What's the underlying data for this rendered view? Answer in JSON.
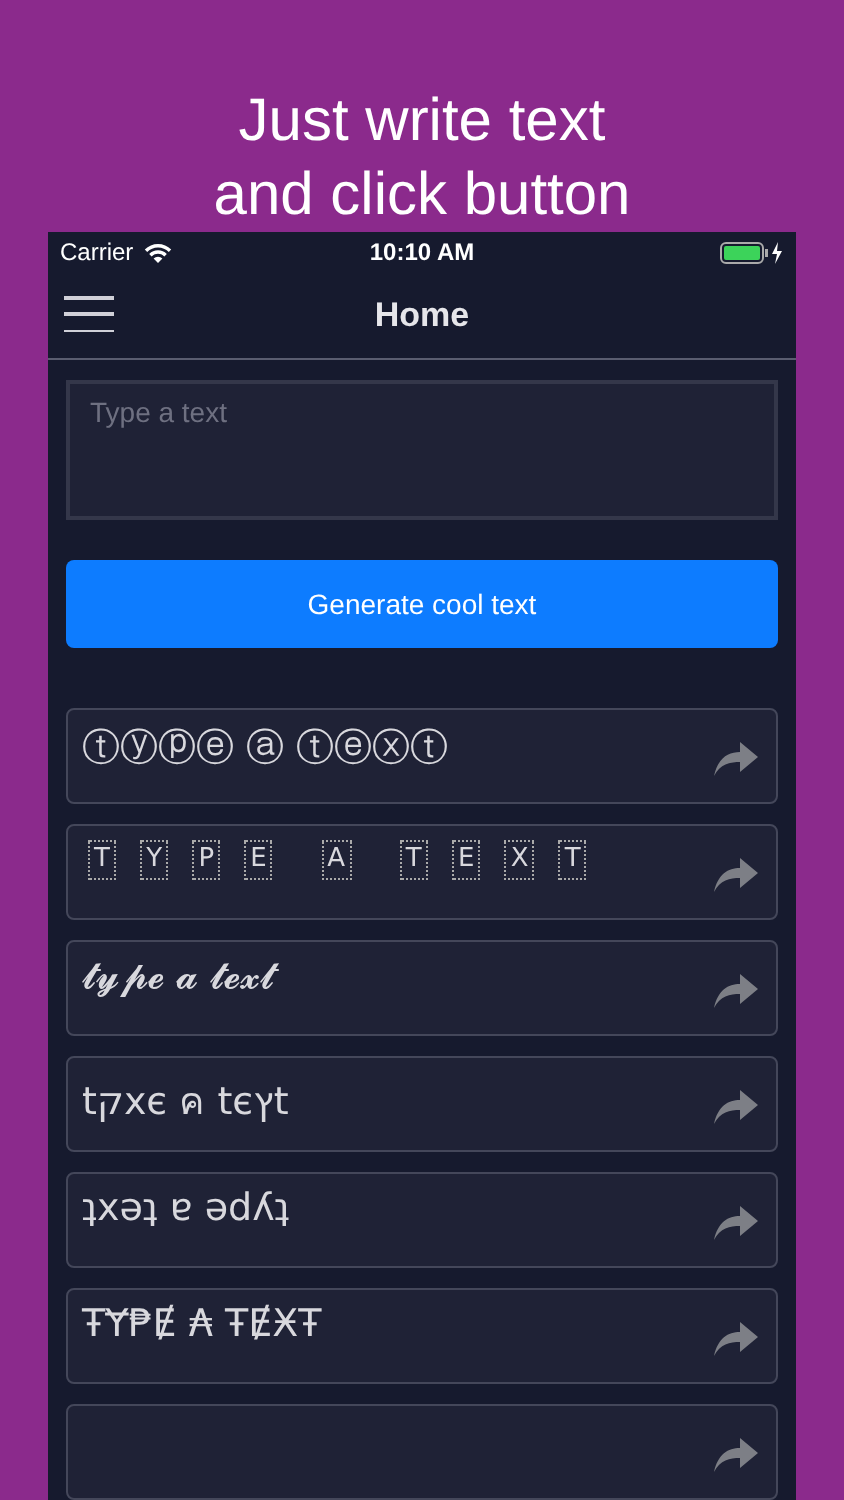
{
  "headline": [
    "Just write text",
    "and click button"
  ],
  "status_bar": {
    "carrier": "Carrier",
    "time": "10:10 AM"
  },
  "nav": {
    "title": "Home"
  },
  "input": {
    "placeholder": "Type a text"
  },
  "generate_button": "Generate cool text",
  "results": [
    {
      "kind": "plain",
      "text": "ⓣⓨⓟⓔ ⓐ ⓣⓔⓧⓣ"
    },
    {
      "kind": "boxed",
      "text": "T Y P E  A  T E X T"
    },
    {
      "kind": "plain",
      "text": "𝓽𝔂𝓹𝓮 𝓪 𝓽𝓮𝔁𝓽"
    },
    {
      "kind": "plain",
      "text": "tקxє ค tєץt"
    },
    {
      "kind": "plain",
      "text": "ʇxǝʇ ɐ ǝdʎʇ"
    },
    {
      "kind": "plain",
      "text": "ŦɎ₱Ɇ ₳ ŦɆӾŦ"
    },
    {
      "kind": "empty"
    }
  ]
}
